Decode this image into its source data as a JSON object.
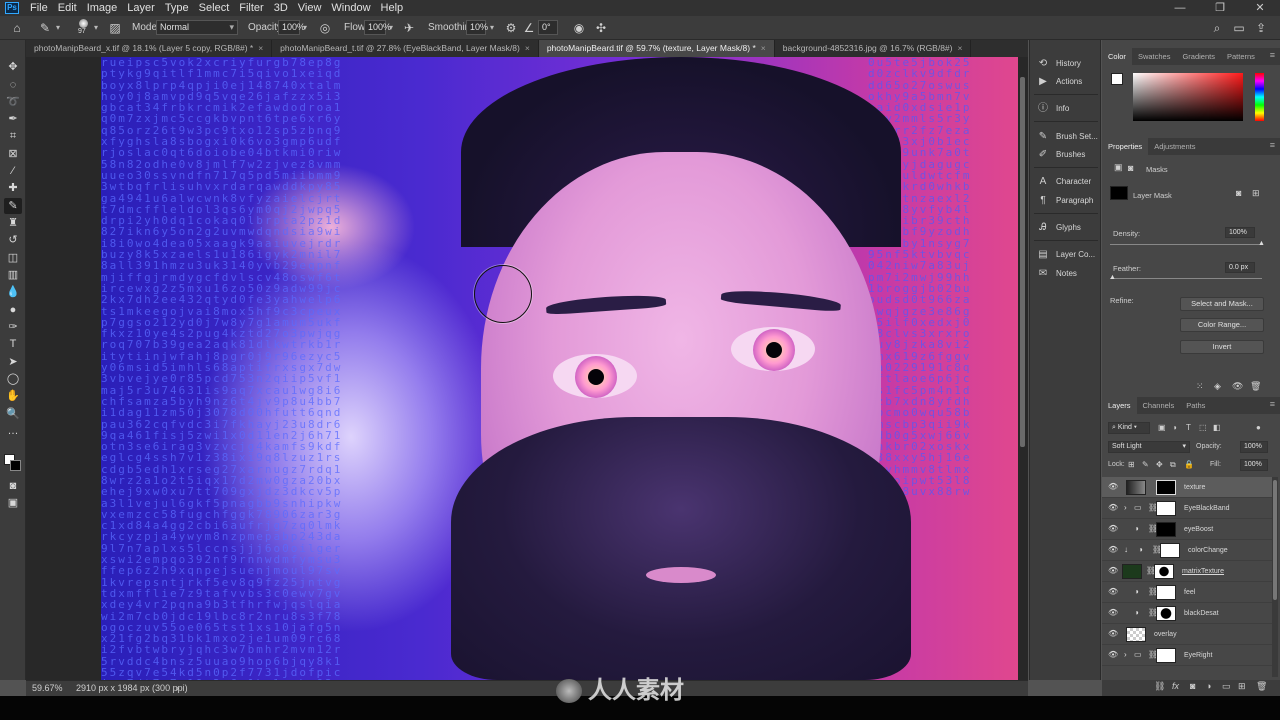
{
  "app": {
    "logo": "Ps"
  },
  "menu": [
    "File",
    "Edit",
    "Image",
    "Layer",
    "Type",
    "Select",
    "Filter",
    "3D",
    "View",
    "Window",
    "Help"
  ],
  "window_controls": {
    "minimize": "—",
    "maximize": "❐",
    "close": "✕"
  },
  "options_bar": {
    "brush_size": "97",
    "mode_label": "Mode:",
    "mode_value": "Normal",
    "opacity_label": "Opacity:",
    "opacity_value": "100%",
    "flow_label": "Flow:",
    "flow_value": "100%",
    "smoothing_label": "Smoothing:",
    "smoothing_value": "10%",
    "angle_value": "0°"
  },
  "tabs": [
    {
      "label": "photoManipBeard_x.tif @ 18.1% (Layer 5 copy, RGB/8#) *",
      "active": false
    },
    {
      "label": "photoManipBeard_t.tif @ 27.8% (EyeBlackBand, Layer Mask/8)",
      "active": false
    },
    {
      "label": "photoManipBeard.tif @ 59.7% (texture, Layer Mask/8) *",
      "active": true
    },
    {
      "label": "background-4852316.jpg @ 16.7% (RGB/8#)",
      "active": false
    }
  ],
  "tab_close": "×",
  "status_bar": {
    "zoom": "59.67%",
    "doc_info": "2910 px x 1984 px (300 ppi)",
    "arrow": "›"
  },
  "mid_panel": [
    {
      "label": "History",
      "icon": "history-icon",
      "glyph": "⟲"
    },
    {
      "label": "Actions",
      "icon": "actions-icon",
      "glyph": "▶"
    },
    {
      "label": "Info",
      "icon": "info-icon",
      "glyph": "ⓘ"
    },
    {
      "label": "Brush Set...",
      "icon": "brush-settings-icon",
      "glyph": "✎"
    },
    {
      "label": "Brushes",
      "icon": "brushes-icon",
      "glyph": "✐"
    },
    {
      "label": "Character",
      "icon": "character-icon",
      "glyph": "A"
    },
    {
      "label": "Paragraph",
      "icon": "paragraph-icon",
      "glyph": "¶"
    },
    {
      "label": "Glyphs",
      "icon": "glyphs-icon",
      "glyph": "Ꭿ"
    },
    {
      "label": "Layer Co...",
      "icon": "layer-comps-icon",
      "glyph": "▤"
    },
    {
      "label": "Notes",
      "icon": "notes-icon",
      "glyph": "✉"
    }
  ],
  "color_panel": {
    "tabs": [
      "Color",
      "Swatches",
      "Gradients",
      "Patterns"
    ],
    "active": "Color"
  },
  "properties_panel": {
    "tabs": [
      "Properties",
      "Adjustments"
    ],
    "masks_label": "Masks",
    "layer_mask_label": "Layer Mask",
    "density_label": "Density:",
    "density_value": "100%",
    "density_level": 100,
    "feather_label": "Feather:",
    "feather_value": "0.0 px",
    "feather_level": 0,
    "refine_label": "Refine:",
    "select_and_mask": "Select and Mask...",
    "color_range": "Color Range...",
    "invert": "Invert"
  },
  "layers_panel": {
    "tabs": [
      "Layers",
      "Channels",
      "Paths"
    ],
    "filter_kind": "Kind",
    "blend_mode": "Soft Light",
    "opacity_label": "Opacity:",
    "opacity_value": "100%",
    "lock_label": "Lock:",
    "fill_label": "Fill:",
    "fill_value": "100%",
    "layers": [
      {
        "name": "texture",
        "selected": true
      },
      {
        "name": "EyeBlackBand",
        "selected": false
      },
      {
        "name": "eyeBoost",
        "selected": false
      },
      {
        "name": "colorChange",
        "selected": false
      },
      {
        "name": "matrixTexture",
        "selected": false
      },
      {
        "name": "feel",
        "selected": false
      },
      {
        "name": "blackDesat",
        "selected": false
      },
      {
        "name": "overlay",
        "selected": false
      },
      {
        "name": "EyeRight",
        "selected": false
      }
    ]
  },
  "watermark": {
    "text": "人人素材"
  },
  "colors": {
    "accent": "#31a8ff",
    "panel": "#474747",
    "bar": "#3c3c3c"
  }
}
